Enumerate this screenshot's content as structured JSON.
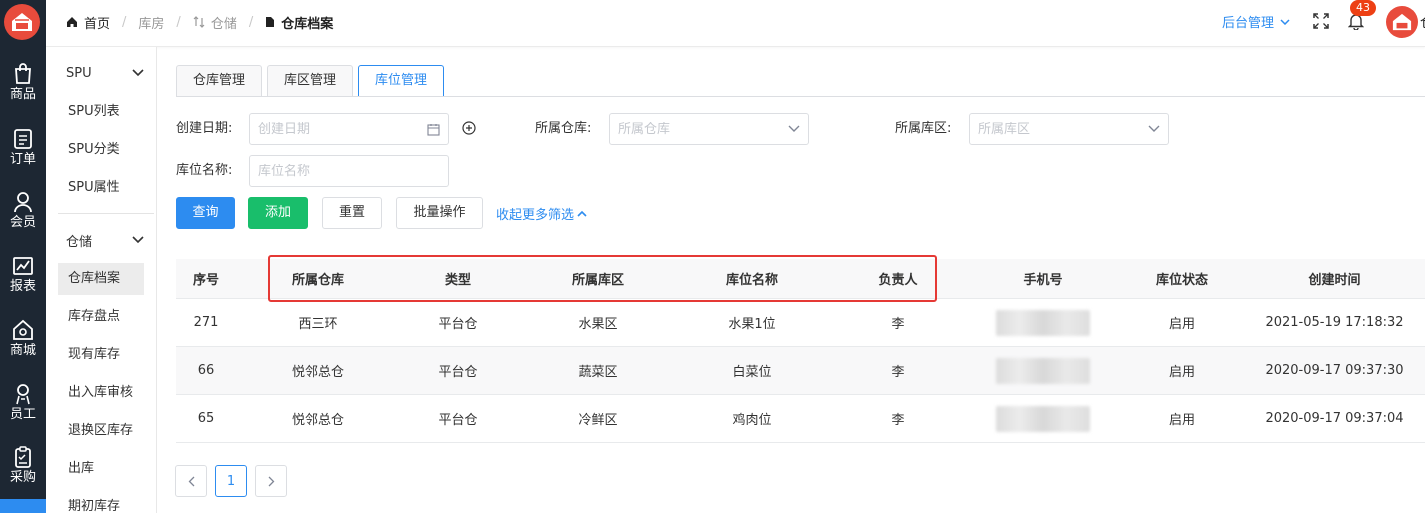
{
  "header": {
    "breadcrumb": [
      {
        "label": "首页",
        "icon": "home-icon"
      },
      {
        "label": "库房",
        "icon": ""
      },
      {
        "label": "仓储",
        "icon": "swap-icon"
      },
      {
        "label": "仓库档案",
        "icon": "file-icon"
      }
    ],
    "admin_menu": "后台管理",
    "notification_count": "43"
  },
  "rail": {
    "items": [
      {
        "label": "商品",
        "icon": "bag-icon"
      },
      {
        "label": "订单",
        "icon": "list-icon"
      },
      {
        "label": "会员",
        "icon": "user-icon"
      },
      {
        "label": "报表",
        "icon": "chart-icon"
      },
      {
        "label": "商城",
        "icon": "store-icon"
      },
      {
        "label": "员工",
        "icon": "staff-icon"
      },
      {
        "label": "采购",
        "icon": "clipboard-icon"
      }
    ]
  },
  "sidebar": {
    "groups": [
      {
        "label": "SPU",
        "items": [
          "SPU列表",
          "SPU分类",
          "SPU属性"
        ]
      },
      {
        "label": "仓储",
        "items": [
          "仓库档案",
          "库存盘点",
          "现有库存",
          "出入库审核",
          "退换区库存",
          "出库",
          "期初库存"
        ]
      }
    ],
    "active_item": "仓库档案"
  },
  "tabs": [
    {
      "label": "仓库管理",
      "active": false
    },
    {
      "label": "库区管理",
      "active": false
    },
    {
      "label": "库位管理",
      "active": true
    }
  ],
  "filters": {
    "create_date": {
      "label": "创建日期:",
      "placeholder": "创建日期"
    },
    "warehouse": {
      "label": "所属仓库:",
      "placeholder": "所属仓库"
    },
    "area": {
      "label": "所属库区:",
      "placeholder": "所属库区"
    },
    "location_name": {
      "label": "库位名称:",
      "placeholder": "库位名称"
    }
  },
  "buttons": {
    "query": "查询",
    "add": "添加",
    "reset": "重置",
    "batch": "批量操作",
    "collapse": "收起更多筛选"
  },
  "colors": {
    "primary": "#2d8cf0",
    "success": "#19be6b",
    "highlight": "#e53935",
    "rail_bg": "#1d2733"
  },
  "table": {
    "columns": [
      "序号",
      "所属仓库",
      "类型",
      "所属库区",
      "库位名称",
      "负责人",
      "手机号",
      "库位状态",
      "创建时间"
    ],
    "rows": [
      {
        "id": "271",
        "warehouse": "西三环",
        "type": "平台仓",
        "area": "水果区",
        "location": "水果1位",
        "owner": "李",
        "status": "启用",
        "created": "2021-05-19 17:18:32"
      },
      {
        "id": "66",
        "warehouse": "悦邻总仓",
        "type": "平台仓",
        "area": "蔬菜区",
        "location": "白菜位",
        "owner": "李",
        "status": "启用",
        "created": "2020-09-17 09:37:30"
      },
      {
        "id": "65",
        "warehouse": "悦邻总仓",
        "type": "平台仓",
        "area": "冷鲜区",
        "location": "鸡肉位",
        "owner": "李",
        "status": "启用",
        "created": "2020-09-17 09:37:04"
      }
    ]
  },
  "pagination": {
    "current_page": "1"
  }
}
